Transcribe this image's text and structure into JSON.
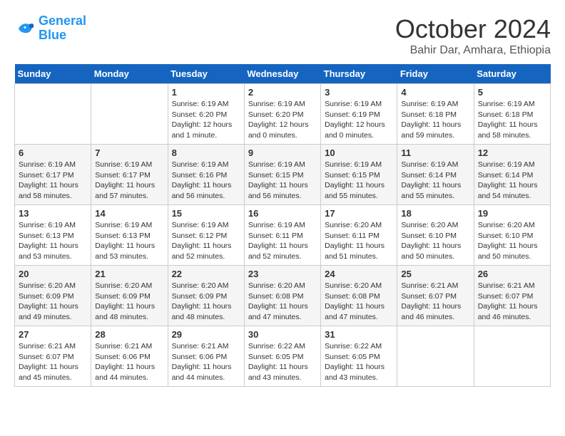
{
  "logo": {
    "text_general": "General",
    "text_blue": "Blue"
  },
  "title": "October 2024",
  "subtitle": "Bahir Dar, Amhara, Ethiopia",
  "headers": [
    "Sunday",
    "Monday",
    "Tuesday",
    "Wednesday",
    "Thursday",
    "Friday",
    "Saturday"
  ],
  "weeks": [
    [
      {
        "day": "",
        "sunrise": "",
        "sunset": "",
        "daylight": ""
      },
      {
        "day": "",
        "sunrise": "",
        "sunset": "",
        "daylight": ""
      },
      {
        "day": "1",
        "sunrise": "Sunrise: 6:19 AM",
        "sunset": "Sunset: 6:20 PM",
        "daylight": "Daylight: 12 hours and 1 minute."
      },
      {
        "day": "2",
        "sunrise": "Sunrise: 6:19 AM",
        "sunset": "Sunset: 6:20 PM",
        "daylight": "Daylight: 12 hours and 0 minutes."
      },
      {
        "day": "3",
        "sunrise": "Sunrise: 6:19 AM",
        "sunset": "Sunset: 6:19 PM",
        "daylight": "Daylight: 12 hours and 0 minutes."
      },
      {
        "day": "4",
        "sunrise": "Sunrise: 6:19 AM",
        "sunset": "Sunset: 6:18 PM",
        "daylight": "Daylight: 11 hours and 59 minutes."
      },
      {
        "day": "5",
        "sunrise": "Sunrise: 6:19 AM",
        "sunset": "Sunset: 6:18 PM",
        "daylight": "Daylight: 11 hours and 58 minutes."
      }
    ],
    [
      {
        "day": "6",
        "sunrise": "Sunrise: 6:19 AM",
        "sunset": "Sunset: 6:17 PM",
        "daylight": "Daylight: 11 hours and 58 minutes."
      },
      {
        "day": "7",
        "sunrise": "Sunrise: 6:19 AM",
        "sunset": "Sunset: 6:17 PM",
        "daylight": "Daylight: 11 hours and 57 minutes."
      },
      {
        "day": "8",
        "sunrise": "Sunrise: 6:19 AM",
        "sunset": "Sunset: 6:16 PM",
        "daylight": "Daylight: 11 hours and 56 minutes."
      },
      {
        "day": "9",
        "sunrise": "Sunrise: 6:19 AM",
        "sunset": "Sunset: 6:15 PM",
        "daylight": "Daylight: 11 hours and 56 minutes."
      },
      {
        "day": "10",
        "sunrise": "Sunrise: 6:19 AM",
        "sunset": "Sunset: 6:15 PM",
        "daylight": "Daylight: 11 hours and 55 minutes."
      },
      {
        "day": "11",
        "sunrise": "Sunrise: 6:19 AM",
        "sunset": "Sunset: 6:14 PM",
        "daylight": "Daylight: 11 hours and 55 minutes."
      },
      {
        "day": "12",
        "sunrise": "Sunrise: 6:19 AM",
        "sunset": "Sunset: 6:14 PM",
        "daylight": "Daylight: 11 hours and 54 minutes."
      }
    ],
    [
      {
        "day": "13",
        "sunrise": "Sunrise: 6:19 AM",
        "sunset": "Sunset: 6:13 PM",
        "daylight": "Daylight: 11 hours and 53 minutes."
      },
      {
        "day": "14",
        "sunrise": "Sunrise: 6:19 AM",
        "sunset": "Sunset: 6:13 PM",
        "daylight": "Daylight: 11 hours and 53 minutes."
      },
      {
        "day": "15",
        "sunrise": "Sunrise: 6:19 AM",
        "sunset": "Sunset: 6:12 PM",
        "daylight": "Daylight: 11 hours and 52 minutes."
      },
      {
        "day": "16",
        "sunrise": "Sunrise: 6:19 AM",
        "sunset": "Sunset: 6:11 PM",
        "daylight": "Daylight: 11 hours and 52 minutes."
      },
      {
        "day": "17",
        "sunrise": "Sunrise: 6:20 AM",
        "sunset": "Sunset: 6:11 PM",
        "daylight": "Daylight: 11 hours and 51 minutes."
      },
      {
        "day": "18",
        "sunrise": "Sunrise: 6:20 AM",
        "sunset": "Sunset: 6:10 PM",
        "daylight": "Daylight: 11 hours and 50 minutes."
      },
      {
        "day": "19",
        "sunrise": "Sunrise: 6:20 AM",
        "sunset": "Sunset: 6:10 PM",
        "daylight": "Daylight: 11 hours and 50 minutes."
      }
    ],
    [
      {
        "day": "20",
        "sunrise": "Sunrise: 6:20 AM",
        "sunset": "Sunset: 6:09 PM",
        "daylight": "Daylight: 11 hours and 49 minutes."
      },
      {
        "day": "21",
        "sunrise": "Sunrise: 6:20 AM",
        "sunset": "Sunset: 6:09 PM",
        "daylight": "Daylight: 11 hours and 48 minutes."
      },
      {
        "day": "22",
        "sunrise": "Sunrise: 6:20 AM",
        "sunset": "Sunset: 6:09 PM",
        "daylight": "Daylight: 11 hours and 48 minutes."
      },
      {
        "day": "23",
        "sunrise": "Sunrise: 6:20 AM",
        "sunset": "Sunset: 6:08 PM",
        "daylight": "Daylight: 11 hours and 47 minutes."
      },
      {
        "day": "24",
        "sunrise": "Sunrise: 6:20 AM",
        "sunset": "Sunset: 6:08 PM",
        "daylight": "Daylight: 11 hours and 47 minutes."
      },
      {
        "day": "25",
        "sunrise": "Sunrise: 6:21 AM",
        "sunset": "Sunset: 6:07 PM",
        "daylight": "Daylight: 11 hours and 46 minutes."
      },
      {
        "day": "26",
        "sunrise": "Sunrise: 6:21 AM",
        "sunset": "Sunset: 6:07 PM",
        "daylight": "Daylight: 11 hours and 46 minutes."
      }
    ],
    [
      {
        "day": "27",
        "sunrise": "Sunrise: 6:21 AM",
        "sunset": "Sunset: 6:07 PM",
        "daylight": "Daylight: 11 hours and 45 minutes."
      },
      {
        "day": "28",
        "sunrise": "Sunrise: 6:21 AM",
        "sunset": "Sunset: 6:06 PM",
        "daylight": "Daylight: 11 hours and 44 minutes."
      },
      {
        "day": "29",
        "sunrise": "Sunrise: 6:21 AM",
        "sunset": "Sunset: 6:06 PM",
        "daylight": "Daylight: 11 hours and 44 minutes."
      },
      {
        "day": "30",
        "sunrise": "Sunrise: 6:22 AM",
        "sunset": "Sunset: 6:05 PM",
        "daylight": "Daylight: 11 hours and 43 minutes."
      },
      {
        "day": "31",
        "sunrise": "Sunrise: 6:22 AM",
        "sunset": "Sunset: 6:05 PM",
        "daylight": "Daylight: 11 hours and 43 minutes."
      },
      {
        "day": "",
        "sunrise": "",
        "sunset": "",
        "daylight": ""
      },
      {
        "day": "",
        "sunrise": "",
        "sunset": "",
        "daylight": ""
      }
    ]
  ]
}
